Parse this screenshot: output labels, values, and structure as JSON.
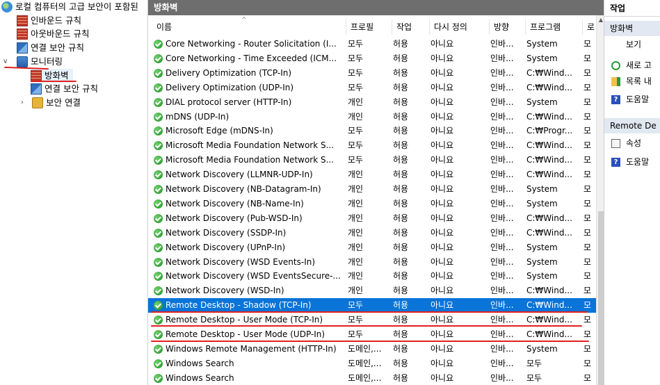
{
  "tree": {
    "root": "로컬 컴퓨터의 고급 보안이 포함된",
    "inbound": "인바운드 규칙",
    "outbound": "아웃바운드 규칙",
    "connsec": "연결 보안 규칙",
    "monitoring": "모니터링",
    "firewall": "방화벽",
    "mon_connsec": "연결 보안 규칙",
    "secassoc": "보안 연결"
  },
  "center": {
    "title": "방화벽",
    "columns": {
      "name": "이름",
      "profile": "프로필",
      "action": "작업",
      "override": "다시 정의",
      "direction": "방향",
      "program": "프로그램",
      "local": "로"
    },
    "rows": [
      {
        "name": "Core Networking - Router Solicitation (I...",
        "profile": "모두",
        "action": "허용",
        "override": "아니요",
        "direction": "인바...",
        "program": "System",
        "local": "모"
      },
      {
        "name": "Core Networking - Time Exceeded (ICM...",
        "profile": "모두",
        "action": "허용",
        "override": "아니요",
        "direction": "인바...",
        "program": "System",
        "local": "모"
      },
      {
        "name": "Delivery Optimization (TCP-In)",
        "profile": "모두",
        "action": "허용",
        "override": "아니요",
        "direction": "인바...",
        "program": "C:₩Wind...",
        "local": "모"
      },
      {
        "name": "Delivery Optimization (UDP-In)",
        "profile": "모두",
        "action": "허용",
        "override": "아니요",
        "direction": "인바...",
        "program": "C:₩Wind...",
        "local": "모"
      },
      {
        "name": "DIAL protocol server (HTTP-In)",
        "profile": "개인",
        "action": "허용",
        "override": "아니요",
        "direction": "인바...",
        "program": "System",
        "local": "모"
      },
      {
        "name": "mDNS (UDP-In)",
        "profile": "개인",
        "action": "허용",
        "override": "아니요",
        "direction": "인바...",
        "program": "C:₩Wind...",
        "local": "모"
      },
      {
        "name": "Microsoft Edge (mDNS-In)",
        "profile": "모두",
        "action": "허용",
        "override": "아니요",
        "direction": "인바...",
        "program": "C:₩Progr...",
        "local": "모"
      },
      {
        "name": "Microsoft Media Foundation Network S...",
        "profile": "모두",
        "action": "허용",
        "override": "아니요",
        "direction": "인바...",
        "program": "C:₩Wind...",
        "local": "모"
      },
      {
        "name": "Microsoft Media Foundation Network S...",
        "profile": "모두",
        "action": "허용",
        "override": "아니요",
        "direction": "인바...",
        "program": "C:₩Wind...",
        "local": "모"
      },
      {
        "name": "Network Discovery (LLMNR-UDP-In)",
        "profile": "개인",
        "action": "허용",
        "override": "아니요",
        "direction": "인바...",
        "program": "C:₩Wind...",
        "local": "모"
      },
      {
        "name": "Network Discovery (NB-Datagram-In)",
        "profile": "개인",
        "action": "허용",
        "override": "아니요",
        "direction": "인바...",
        "program": "System",
        "local": "모"
      },
      {
        "name": "Network Discovery (NB-Name-In)",
        "profile": "개인",
        "action": "허용",
        "override": "아니요",
        "direction": "인바...",
        "program": "System",
        "local": "모"
      },
      {
        "name": "Network Discovery (Pub-WSD-In)",
        "profile": "개인",
        "action": "허용",
        "override": "아니요",
        "direction": "인바...",
        "program": "C:₩Wind...",
        "local": "모"
      },
      {
        "name": "Network Discovery (SSDP-In)",
        "profile": "개인",
        "action": "허용",
        "override": "아니요",
        "direction": "인바...",
        "program": "C:₩Wind...",
        "local": "모"
      },
      {
        "name": "Network Discovery (UPnP-In)",
        "profile": "개인",
        "action": "허용",
        "override": "아니요",
        "direction": "인바...",
        "program": "System",
        "local": "모"
      },
      {
        "name": "Network Discovery (WSD Events-In)",
        "profile": "개인",
        "action": "허용",
        "override": "아니요",
        "direction": "인바...",
        "program": "System",
        "local": "모"
      },
      {
        "name": "Network Discovery (WSD EventsSecure-...",
        "profile": "개인",
        "action": "허용",
        "override": "아니요",
        "direction": "인바...",
        "program": "System",
        "local": "모"
      },
      {
        "name": "Network Discovery (WSD-In)",
        "profile": "개인",
        "action": "허용",
        "override": "아니요",
        "direction": "인바...",
        "program": "C:₩Wind...",
        "local": "모"
      },
      {
        "name": "Remote Desktop - Shadow (TCP-In)",
        "profile": "모두",
        "action": "허용",
        "override": "아니요",
        "direction": "인바...",
        "program": "C:₩Wind...",
        "local": "모",
        "selected": true
      },
      {
        "name": "Remote Desktop - User Mode (TCP-In)",
        "profile": "모두",
        "action": "허용",
        "override": "아니요",
        "direction": "인바...",
        "program": "C:₩Wind...",
        "local": "모"
      },
      {
        "name": "Remote Desktop - User Mode (UDP-In)",
        "profile": "모두",
        "action": "허용",
        "override": "아니요",
        "direction": "인바...",
        "program": "C:₩Wind...",
        "local": "모"
      },
      {
        "name": "Windows Remote Management (HTTP-In)",
        "profile": "도메인,...",
        "action": "허용",
        "override": "아니요",
        "direction": "인바...",
        "program": "System",
        "local": "모"
      },
      {
        "name": "Windows Search",
        "profile": "도메인,...",
        "action": "허용",
        "override": "아니요",
        "direction": "인바...",
        "program": "모두",
        "local": "모"
      },
      {
        "name": "Windows Search",
        "profile": "도메인,...",
        "action": "허용",
        "override": "아니요",
        "direction": "인바...",
        "program": "모두",
        "local": "모"
      }
    ]
  },
  "actions": {
    "title": "작업",
    "section1": "방화벽",
    "view": "보기",
    "refresh": "새로 고",
    "export": "목록 내",
    "help1": "도움말",
    "section2": "Remote De",
    "props": "속성",
    "help2": "도움말"
  },
  "colors": {
    "selection": "#0a74d8",
    "annotation": "#e02020",
    "header": "#6e6e6e"
  }
}
